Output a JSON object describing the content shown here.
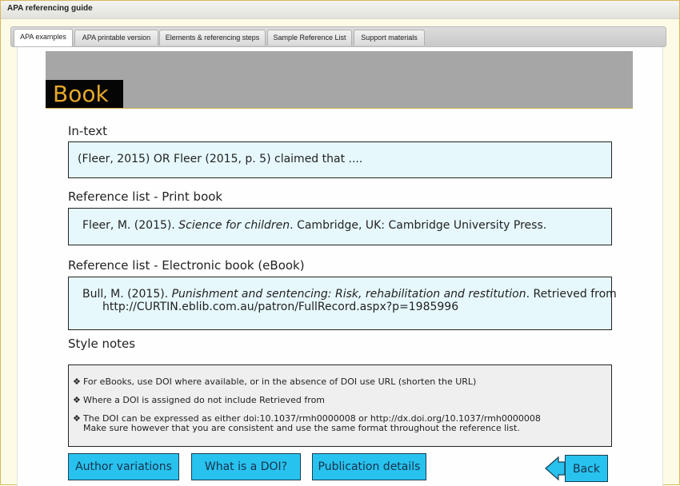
{
  "window": {
    "title": "APA referencing guide"
  },
  "tabs": [
    {
      "label": "APA examples",
      "active": true
    },
    {
      "label": "APA printable version",
      "active": false
    },
    {
      "label": "Elements & referencing steps",
      "active": false
    },
    {
      "label": "Sample Reference List",
      "active": false
    },
    {
      "label": "Support materials",
      "active": false
    }
  ],
  "banner": {
    "title": "Book"
  },
  "sections": {
    "in_text": {
      "heading": "In-text",
      "example": "(Fleer, 2015)   OR   Fleer (2015, p. 5) claimed that ...."
    },
    "print_book": {
      "heading": "Reference list - Print book",
      "author_year": "Fleer, M. (2015). ",
      "title": "Science for children",
      "publisher": ". Cambridge, UK: Cambridge University Press."
    },
    "ebook": {
      "heading": "Reference list - Electronic book (eBook)",
      "author_year": "Bull, M. (2015). ",
      "title": "Punishment and sentencing: Risk, rehabilitation and restitution",
      "retrieved": ". Retrieved from",
      "url": "http://CURTIN.eblib.com.au/patron/FullRecord.aspx?p=1985996"
    },
    "style_notes": {
      "heading": "Style notes",
      "bullet_symbol": "❖",
      "items": [
        "For eBooks, use DOI where available, or in the absence of DOI use URL (shorten the URL)",
        "Where a DOI is assigned do not include Retrieved from",
        "The DOI can be expressed as either doi:10.1037/rmh0000008 or http://dx.doi.org/10.1037/rmh0000008"
      ],
      "item_continuation": "Make sure however that you are consistent and use the same format throughout the reference list."
    }
  },
  "buttons": {
    "author_variations": "Author variations",
    "what_is_doi": "What is a DOI?",
    "publication_details": "Publication details",
    "back": "Back"
  },
  "colors": {
    "banner_text": "#e6a82a",
    "button_fill": "#28c2ef",
    "example_box": "#e6f8fc",
    "notes_box": "#efefef"
  },
  "icons": {
    "back": "left-arrow-icon",
    "note_bullet": "diamond-bullet-icon"
  }
}
